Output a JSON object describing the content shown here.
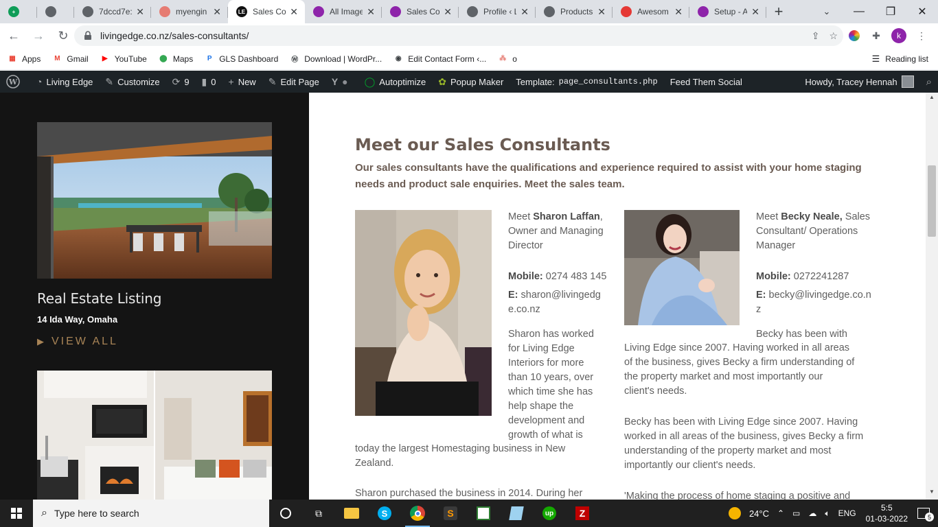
{
  "browser": {
    "tabs": [
      {
        "label": "",
        "favicon_color": "#0f9d58",
        "favicon_text": "+",
        "narrow": true
      },
      {
        "label": "",
        "favicon_color": "#5f6368",
        "favicon_text": "",
        "narrow": true
      },
      {
        "label": "7dccd7e:",
        "favicon_color": "#5f6368",
        "favicon_text": ""
      },
      {
        "label": "myengin",
        "favicon_color": "#e67c73",
        "favicon_text": ""
      },
      {
        "label": "Sales Co",
        "favicon_color": "#111111",
        "favicon_text": "LE",
        "active": true
      },
      {
        "label": "All Image",
        "favicon_color": "#8e24aa",
        "favicon_text": ""
      },
      {
        "label": "Sales Co",
        "favicon_color": "#8e24aa",
        "favicon_text": ""
      },
      {
        "label": "Profile ‹ L",
        "favicon_color": "#5f6368",
        "favicon_text": ""
      },
      {
        "label": "Products",
        "favicon_color": "#5f6368",
        "favicon_text": ""
      },
      {
        "label": "Awesom",
        "favicon_color": "#e53935",
        "favicon_text": ""
      },
      {
        "label": "Setup - A",
        "favicon_color": "#8e24aa",
        "favicon_text": ""
      }
    ],
    "url": "livingedge.co.nz/sales-consultants/",
    "profile_initial": "k"
  },
  "bookmarks": {
    "items": [
      {
        "label": "Apps",
        "icon": "apps-grid-icon",
        "color": "#ea4335"
      },
      {
        "label": "Gmail",
        "icon": "gmail-icon",
        "color": "#ea4335"
      },
      {
        "label": "YouTube",
        "icon": "youtube-icon",
        "color": "#ff0000"
      },
      {
        "label": "Maps",
        "icon": "maps-pin-icon",
        "color": "#34a853"
      },
      {
        "label": "GLS Dashboard",
        "icon": "gls-icon",
        "color": "#1a73e8"
      },
      {
        "label": "Download | WordPr...",
        "icon": "wordpress-icon",
        "color": "#3c4043"
      },
      {
        "label": "Edit Contact Form ‹...",
        "icon": "globe-icon",
        "color": "#3c4043"
      },
      {
        "label": "o",
        "icon": "asana-icon",
        "color": "#e67c73"
      }
    ],
    "reading_list": "Reading list"
  },
  "wpbar": {
    "site": "Living Edge",
    "customize": "Customize",
    "updates": "9",
    "comments": "0",
    "new": "New",
    "edit_page": "Edit Page",
    "autoptimize": "Autoptimize",
    "popup_maker": "Popup Maker",
    "template_label": "Template:",
    "template_value": "page_consultants.php",
    "feed": "Feed Them Social",
    "howdy": "Howdy, Tracey Hennah"
  },
  "sidebar": {
    "listing_title": "Real Estate Listing",
    "listing_address": "14 Ida Way, Omaha",
    "view_all": "VIEW ALL"
  },
  "main": {
    "title": "Meet our Sales Consultants",
    "intro": "Our sales consultants have the qualifications and experience required to assist with your home staging needs and product sale enquiries. Meet the sales team.",
    "consultants": [
      {
        "meet": "Meet ",
        "name": "Sharon Laffan",
        "role_sep": ", ",
        "role_line1": "Owner and Managing",
        "role_line2": "Director",
        "mobile_label": "Mobile:",
        "mobile": " 0274 483 145",
        "email_label": "E:",
        "email_line1": " sharon@livingedg",
        "email_line2": "e.co.nz",
        "bio_lines": [
          "Sharon has worked",
          "for Living Edge",
          "Interiors for more",
          "than 10 years, over",
          "which time she has",
          "help shape the",
          "development and",
          "growth of what is"
        ],
        "bio_tail_lines": [
          "today the largest Homestaging business in New",
          "Zealand."
        ],
        "bio2": "Sharon purchased the business in 2014. During her"
      },
      {
        "meet": "Meet ",
        "name": "Becky Neale,",
        "role_sep": " Sales",
        "role_line1": "Consultant/ Operations",
        "role_line2": "Manager",
        "mobile_label": "Mobile:",
        "mobile": " 0272241287",
        "email_label": "E:",
        "email_line1": " becky@livingedge.co.n",
        "email_line2": "z",
        "bio_lines": [
          "Becky has been with",
          "Living Edge since 2007.  Having worked in all areas",
          "of the business, gives Becky a firm understanding of",
          "the property market and most importantly our",
          "client's needs."
        ],
        "bio2_lines": [
          "Becky has been with Living Edge since 2007.  Having",
          "worked in all areas of the business, gives Becky a firm",
          "understanding of the property market and most",
          "importantly our client's needs."
        ],
        "bio3": "'Making the process of home staging a positive and"
      }
    ]
  },
  "taskbar": {
    "search_placeholder": "Type here to search",
    "weather": "24°C",
    "lang": "ENG",
    "time": "5:5",
    "date": "01-03-2022",
    "notifications": "5"
  }
}
